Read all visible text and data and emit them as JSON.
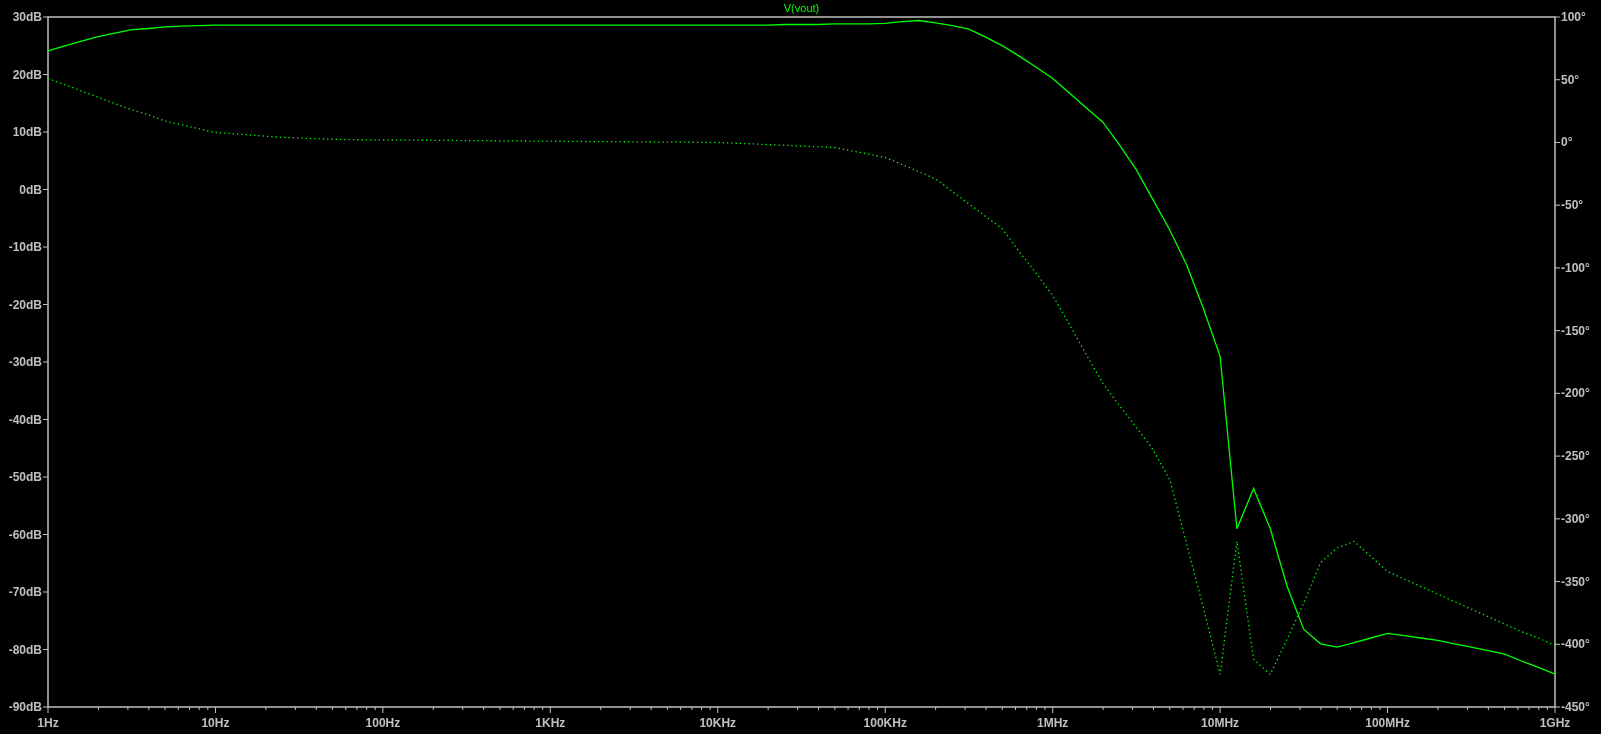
{
  "plot": {
    "chart_data": {
      "type": "line",
      "title": "V(vout)",
      "ylim": [
        -90,
        30
      ],
      "y2lim": [
        -450,
        100
      ],
      "categories": [
        "1Hz",
        null,
        null,
        null,
        null,
        null,
        null,
        null,
        null,
        null,
        "10Hz",
        null,
        null,
        null,
        null,
        null,
        null,
        null,
        null,
        null,
        "100Hz",
        null,
        null,
        null,
        null,
        null,
        null,
        null,
        null,
        null,
        "1KHz",
        null,
        null,
        null,
        null,
        null,
        null,
        null,
        null,
        null,
        "10KHz",
        null,
        null,
        null,
        null,
        null,
        null,
        null,
        null,
        null,
        "100KHz",
        null,
        null,
        null,
        null,
        null,
        null,
        null,
        null,
        null,
        "1MHz",
        null,
        null,
        null,
        null,
        null,
        null,
        null,
        null,
        null,
        "10MHz",
        null,
        null,
        null,
        null,
        null,
        null,
        null,
        null,
        null,
        "100MHz",
        null,
        null,
        null,
        null,
        null,
        null,
        null,
        null,
        null,
        "1GHz"
      ],
      "yticks": [
        {
          "value": 30,
          "label": "30dB"
        },
        {
          "value": 20,
          "label": "20dB"
        },
        {
          "value": 10,
          "label": "10dB"
        },
        {
          "value": 0,
          "label": "0dB"
        },
        {
          "value": -10,
          "label": "-10dB"
        },
        {
          "value": -20,
          "label": "-20dB"
        },
        {
          "value": -30,
          "label": "-30dB"
        },
        {
          "value": -40,
          "label": "-40dB"
        },
        {
          "value": -50,
          "label": "-50dB"
        },
        {
          "value": -60,
          "label": "-60dB"
        },
        {
          "value": -70,
          "label": "-70dB"
        },
        {
          "value": -80,
          "label": "-80dB"
        },
        {
          "value": -90,
          "label": "-90dB"
        }
      ],
      "y2ticks": [
        {
          "value": 100,
          "label": "100°"
        },
        {
          "value": 50,
          "label": "50°"
        },
        {
          "value": 0,
          "label": "0°"
        },
        {
          "value": -50,
          "label": "-50°"
        },
        {
          "value": -100,
          "label": "-100°"
        },
        {
          "value": -150,
          "label": "-150°"
        },
        {
          "value": -200,
          "label": "-200°"
        },
        {
          "value": -250,
          "label": "-250°"
        },
        {
          "value": -300,
          "label": "-300°"
        },
        {
          "value": -350,
          "label": "-350°"
        },
        {
          "value": -400,
          "label": "-400°"
        },
        {
          "value": -450,
          "label": "-450°"
        }
      ],
      "series": [
        {
          "color": "#00ff00",
          "values": [
            24.1,
            25.0,
            25.8,
            26.6,
            27.2,
            27.8,
            28.0,
            28.3,
            28.4,
            28.5,
            28.6,
            28.6,
            28.6,
            28.6,
            28.6,
            28.6,
            28.6,
            28.6,
            28.6,
            28.6,
            28.6,
            28.6,
            28.6,
            28.6,
            28.6,
            28.6,
            28.6,
            28.6,
            28.6,
            28.6,
            28.6,
            28.6,
            28.6,
            28.6,
            28.6,
            28.6,
            28.6,
            28.6,
            28.6,
            28.6,
            28.6,
            28.6,
            28.6,
            28.6,
            28.7,
            28.7,
            28.7,
            28.8,
            28.8,
            28.8,
            28.9,
            29.2,
            29.4,
            29.0,
            28.5,
            27.9,
            26.5,
            25.0,
            23.2,
            21.3,
            19.3,
            16.8,
            14.2,
            11.7,
            7.7,
            3.4,
            -1.8,
            -7.1,
            -13.1,
            -20.7,
            -29,
            -59,
            -52,
            -59,
            -69,
            -76.5,
            -79,
            -79.6,
            -78.8,
            -78.0,
            -77.2,
            -77.6,
            -78.0,
            -78.4,
            -79.0,
            -79.6,
            -80.2,
            -80.8,
            -82.0,
            -83.1,
            -84.3
          ]
        },
        {
          "color": "#00ff00",
          "axis": "y2",
          "line_style": "dotted",
          "values": [
            51,
            46,
            41,
            36,
            31,
            26,
            22,
            17,
            14,
            11,
            8,
            7,
            6,
            5,
            4,
            3.5,
            3,
            2.5,
            2.3,
            2.1,
            2,
            1.9,
            1.8,
            1.7,
            1.6,
            1.5,
            1.4,
            1.3,
            1.2,
            1.1,
            1,
            0.9,
            0.8,
            0.7,
            0.6,
            0.5,
            0.4,
            0.3,
            0.2,
            0.1,
            0,
            -0.6,
            -1.1,
            -1.7,
            -2.3,
            -2.9,
            -3.4,
            -4,
            -6.7,
            -9.3,
            -12,
            -17.6,
            -23.3,
            -29,
            -39,
            -49,
            -59,
            -69,
            -87,
            -104,
            -122,
            -145,
            -169,
            -192,
            -210,
            -227,
            -245,
            -269,
            -320,
            -371,
            -424,
            -318,
            -412,
            -424,
            -396,
            -367,
            -335,
            -323,
            -318,
            -330,
            -342,
            -348,
            -354,
            -360,
            -366,
            -372,
            -378,
            -384,
            -390,
            -395,
            -401
          ]
        }
      ]
    }
  }
}
